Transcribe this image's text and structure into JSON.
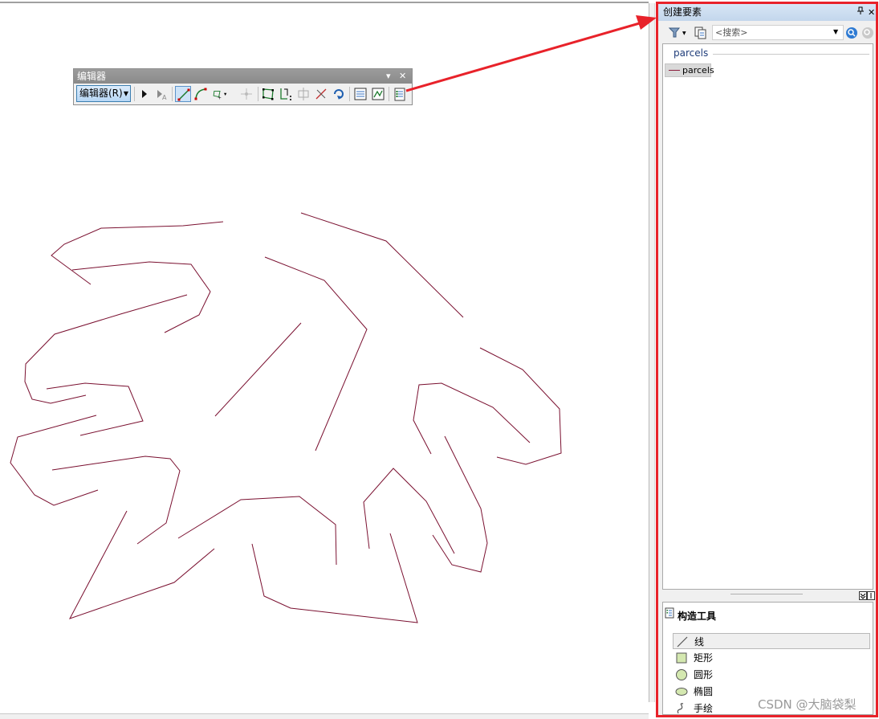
{
  "editor_toolbar": {
    "title": "编辑器",
    "dropdown_label": "编辑器(R)",
    "pin_glyph": "▾",
    "close_glyph": "✕"
  },
  "panel": {
    "title": "创建要素",
    "pin_glyph": "ᵽ",
    "close_glyph": "✕",
    "search_placeholder": "<搜索>",
    "group_heading": "parcels",
    "template_item": "parcels",
    "construction_title": "构造工具",
    "construction_tools": [
      {
        "label": "线",
        "icon": "line-icon"
      },
      {
        "label": "矩形",
        "icon": "rectangle-icon"
      },
      {
        "label": "圆形",
        "icon": "circle-icon"
      },
      {
        "label": "椭圆",
        "icon": "ellipse-icon"
      },
      {
        "label": "手绘",
        "icon": "freehand-icon"
      }
    ]
  },
  "colors": {
    "feature_line": "#7a1030",
    "highlight_box": "#e8222a",
    "arrow": "#e8222a"
  },
  "watermark": "CSDN @大脑袋梨"
}
